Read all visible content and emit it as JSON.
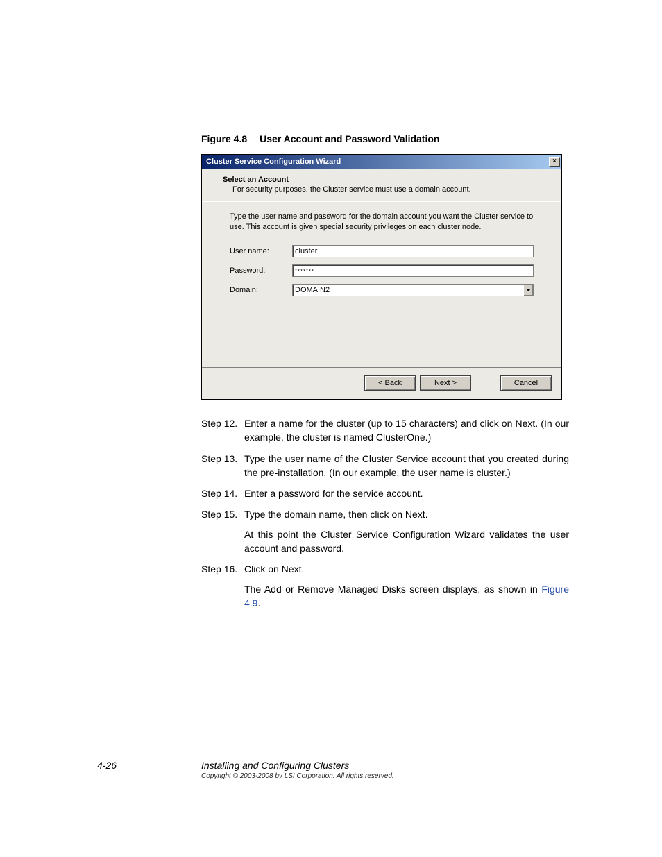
{
  "figure": {
    "label": "Figure 4.8",
    "title": "User Account and Password Validation"
  },
  "dialog": {
    "title": "Cluster Service Configuration Wizard",
    "close_glyph": "×",
    "header_title": "Select an Account",
    "header_sub": "For security purposes, the Cluster service must use a domain account.",
    "body_instruction": "Type the user name and password for the domain account you want the Cluster service to use. This account is given special security privileges on each cluster node.",
    "username_label": "User name:",
    "username_value": "cluster",
    "password_label": "Password:",
    "password_value": "xxxxxxx",
    "domain_label": "Domain:",
    "domain_value": "DOMAIN2",
    "back_label": "< Back",
    "next_label": "Next >",
    "cancel_label": "Cancel"
  },
  "steps": {
    "s12": {
      "label": "Step 12.",
      "text": "Enter a name for the cluster (up to 15 characters) and click on Next. (In our example, the cluster is named ClusterOne.)"
    },
    "s13": {
      "label": "Step 13.",
      "text": "Type the user name of the Cluster Service account that you created during the pre-installation. (In our example, the user name is cluster.)"
    },
    "s14": {
      "label": "Step 14.",
      "text": "Enter a password for the service account."
    },
    "s15": {
      "label": "Step 15.",
      "text": "Type the domain name, then click on Next.",
      "text2": "At this point the Cluster Service Configuration Wizard validates the user account and password."
    },
    "s16": {
      "label": "Step 16.",
      "text": "Click on Next.",
      "text2_a": "The Add or Remove Managed Disks screen displays, as shown in ",
      "xref": "Figure 4.9",
      "text2_b": "."
    }
  },
  "footer": {
    "page": "4-26",
    "title": "Installing and Configuring Clusters",
    "copyright": "Copyright © 2003-2008 by LSI Corporation. All rights reserved."
  }
}
